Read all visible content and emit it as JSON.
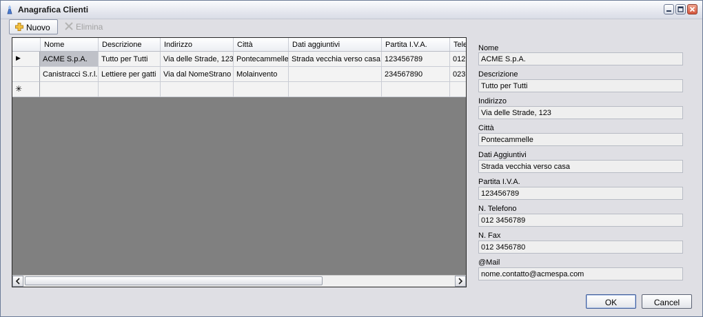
{
  "window": {
    "title": "Anagrafica Clienti"
  },
  "toolbar": {
    "new_label": "Nuovo",
    "delete_label": "Elimina"
  },
  "grid": {
    "columns": [
      "Nome",
      "Descrizione",
      "Indirizzo",
      "Città",
      "Dati aggiuntivi",
      "Partita I.V.A.",
      "Tele"
    ],
    "rows": [
      [
        "ACME S.p.A.",
        "Tutto per Tutti",
        "Via delle Strade, 123",
        "Pontecammelle",
        "Strada vecchia verso casa",
        "123456789",
        "012"
      ],
      [
        "Canistracci S.r.l.",
        "Lettiere per gatti",
        "Via dal NomeStrano",
        "Molainvento",
        "",
        "234567890",
        "023"
      ]
    ],
    "current_row_marker": "▶",
    "new_row_marker": "✳"
  },
  "form": {
    "fields": [
      {
        "label": "Nome",
        "value": "ACME S.p.A."
      },
      {
        "label": "Descrizione",
        "value": "Tutto per Tutti"
      },
      {
        "label": "Indirizzo",
        "value": "Via delle Strade, 123"
      },
      {
        "label": "Città",
        "value": "Pontecammelle"
      },
      {
        "label": "Dati Aggiuntivi",
        "value": "Strada vecchia verso casa"
      },
      {
        "label": "Partita I.V.A.",
        "value": "123456789"
      },
      {
        "label": "N. Telefono",
        "value": "012 3456789"
      },
      {
        "label": "N. Fax",
        "value": "012 3456780"
      },
      {
        "label": "@Mail",
        "value": "nome.contatto@acmespa.com"
      }
    ]
  },
  "buttons": {
    "ok_label": "OK",
    "cancel_label": "Cancel"
  },
  "icons": {
    "app": "app-icon",
    "new": "plus-icon",
    "delete": "x-icon",
    "minimize": "minimize-icon",
    "maximize": "maximize-icon",
    "close": "close-icon"
  }
}
